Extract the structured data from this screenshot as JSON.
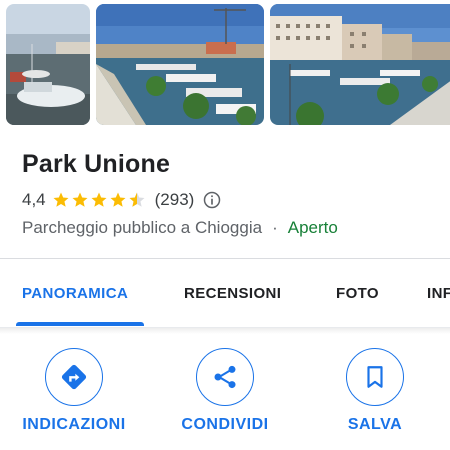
{
  "place": {
    "name": "Park Unione",
    "rating": "4,4",
    "rating_stars": 4.4,
    "reviews": "(293)",
    "category": "Parcheggio pubblico a Chioggia",
    "separator": "·",
    "status": "Aperto"
  },
  "tabs": [
    {
      "label": "PANORAMICA",
      "active": true
    },
    {
      "label": "RECENSIONI",
      "active": false
    },
    {
      "label": "FOTO",
      "active": false
    },
    {
      "label": "INF",
      "active": false
    }
  ],
  "actions": {
    "directions": {
      "label": "INDICAZIONI",
      "icon": "directions-icon"
    },
    "share": {
      "label": "CONDIVIDI",
      "icon": "share-icon"
    },
    "save": {
      "label": "SALVA",
      "icon": "bookmark-icon"
    }
  },
  "photos": [
    {
      "subject": "boats-harbor-photo"
    },
    {
      "subject": "canal-marina-photo"
    },
    {
      "subject": "waterfront-buildings-photo"
    }
  ],
  "colors": {
    "accent": "#1a73e8",
    "star": "#fbbc04",
    "open": "#188038",
    "text": "#202124",
    "secondary_text": "#5f6368"
  }
}
